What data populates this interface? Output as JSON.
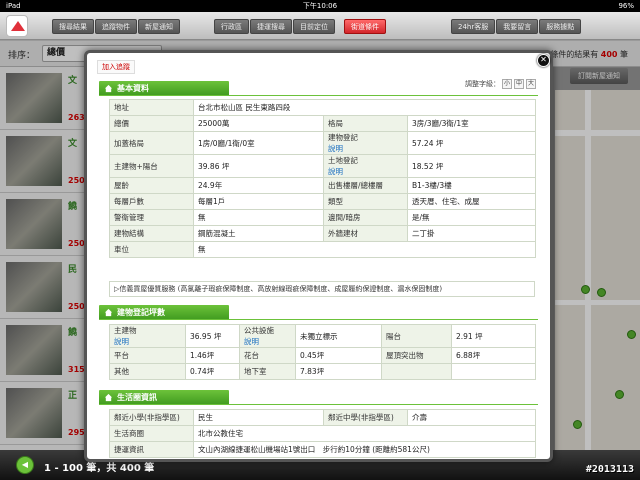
{
  "status": {
    "device": "iPad",
    "time": "下午10:06",
    "battery": "96%"
  },
  "toolbar": {
    "left": [
      "搜尋結果",
      "追蹤物件",
      "新屋通知"
    ],
    "middle": [
      "行政區",
      "捷運搜尋",
      "目前定位",
      "街道條件"
    ],
    "right": [
      "24hr客服",
      "我要留言",
      "服務據點"
    ]
  },
  "sort": {
    "label": "排序：",
    "value": "總價"
  },
  "results": {
    "prefix": "符合條件的結果有",
    "count": "400",
    "suffix": "筆"
  },
  "subscribe_label": "訂閱新屋通知",
  "list_items": [
    {
      "title": "文",
      "price": "263"
    },
    {
      "title": "文",
      "price": "250"
    },
    {
      "title": "饒",
      "price": "250"
    },
    {
      "title": "民",
      "price": "250"
    },
    {
      "title": "饒",
      "price": "315"
    },
    {
      "title": "正",
      "price": "295"
    }
  ],
  "pager": {
    "text": "1 - 100 筆，共 400 筆"
  },
  "watermark": "#2013113",
  "modal": {
    "fav_label": "加入追蹤",
    "fontsize": {
      "label": "調整字級：",
      "small": "小",
      "mid": "中",
      "large": "大"
    },
    "sections": {
      "basic": "基本資料",
      "registered": "建物登記坪數",
      "life": "生活圈資訊"
    },
    "basic": {
      "address_k": "地址",
      "address_v": "台北市松山區 民生東路四段",
      "total_k": "總價",
      "total_v": "25000萬",
      "layout_k": "格局",
      "layout_v": "3房/3廳/3衛/1室",
      "addlayout_k": "加蓋格局",
      "addlayout_v": "1房/0廳/1衛/0室",
      "regarea_k": "建物登記",
      "regarea_link": "說明",
      "regarea_v": "57.24 坪",
      "mainarea_k": "主建物+陽台",
      "mainarea_v": "39.86 坪",
      "landarea_k": "土地登記",
      "landarea_link": "說明",
      "landarea_v": "18.52 坪",
      "age_k": "屋齡",
      "age_v": "24.9年",
      "floor_k": "出售樓層/總樓層",
      "floor_v": "B1-3樓/3樓",
      "units_k": "每層戶數",
      "units_v": "每層1戶",
      "type_k": "類型",
      "type_v": "透天厝、住宅、成屋",
      "guard_k": "警衛管理",
      "guard_v": "無",
      "window_k": "邊間/暗房",
      "window_v": "是/無",
      "struct_k": "建物結構",
      "struct_v": "鋼筋混凝土",
      "facade_k": "外牆建材",
      "facade_v": "二丁掛",
      "parking_k": "車位",
      "parking_v": "無"
    },
    "service": "▷信義買屋優質服務 (高氯離子瑕疵保障制度、高放射線瑕疵保障制度、成屋履約保證制度、漏水保固制度)",
    "registered": {
      "main_k": "主建物",
      "main_link": "說明",
      "main_v": "36.95 坪",
      "public_k": "公共設施",
      "public_link": "說明",
      "public_v": "未獨立標示",
      "balcony_k": "陽台",
      "balcony_v": "2.91 坪",
      "platform_k": "平台",
      "platform_v": "1.46坪",
      "garden_k": "花台",
      "garden_v": "0.45坪",
      "roof_k": "屋頂突出物",
      "roof_v": "6.88坪",
      "other_k": "其他",
      "other_v": "0.74坪",
      "basement_k": "地下室",
      "basement_v": "7.83坪"
    },
    "life": {
      "elem_k": "鄰近小學(非指學區)",
      "elem_v": "民生",
      "junior_k": "鄰近中學(非指學區)",
      "junior_v": "介壽",
      "shop_k": "生活商圈",
      "shop_v": "北市公教住宅",
      "mrt_k": "捷運資訊",
      "mrt_v": "文山內湖線捷運松山機場站1號出口　步行約10分鐘 (距離約581公尺)"
    }
  }
}
